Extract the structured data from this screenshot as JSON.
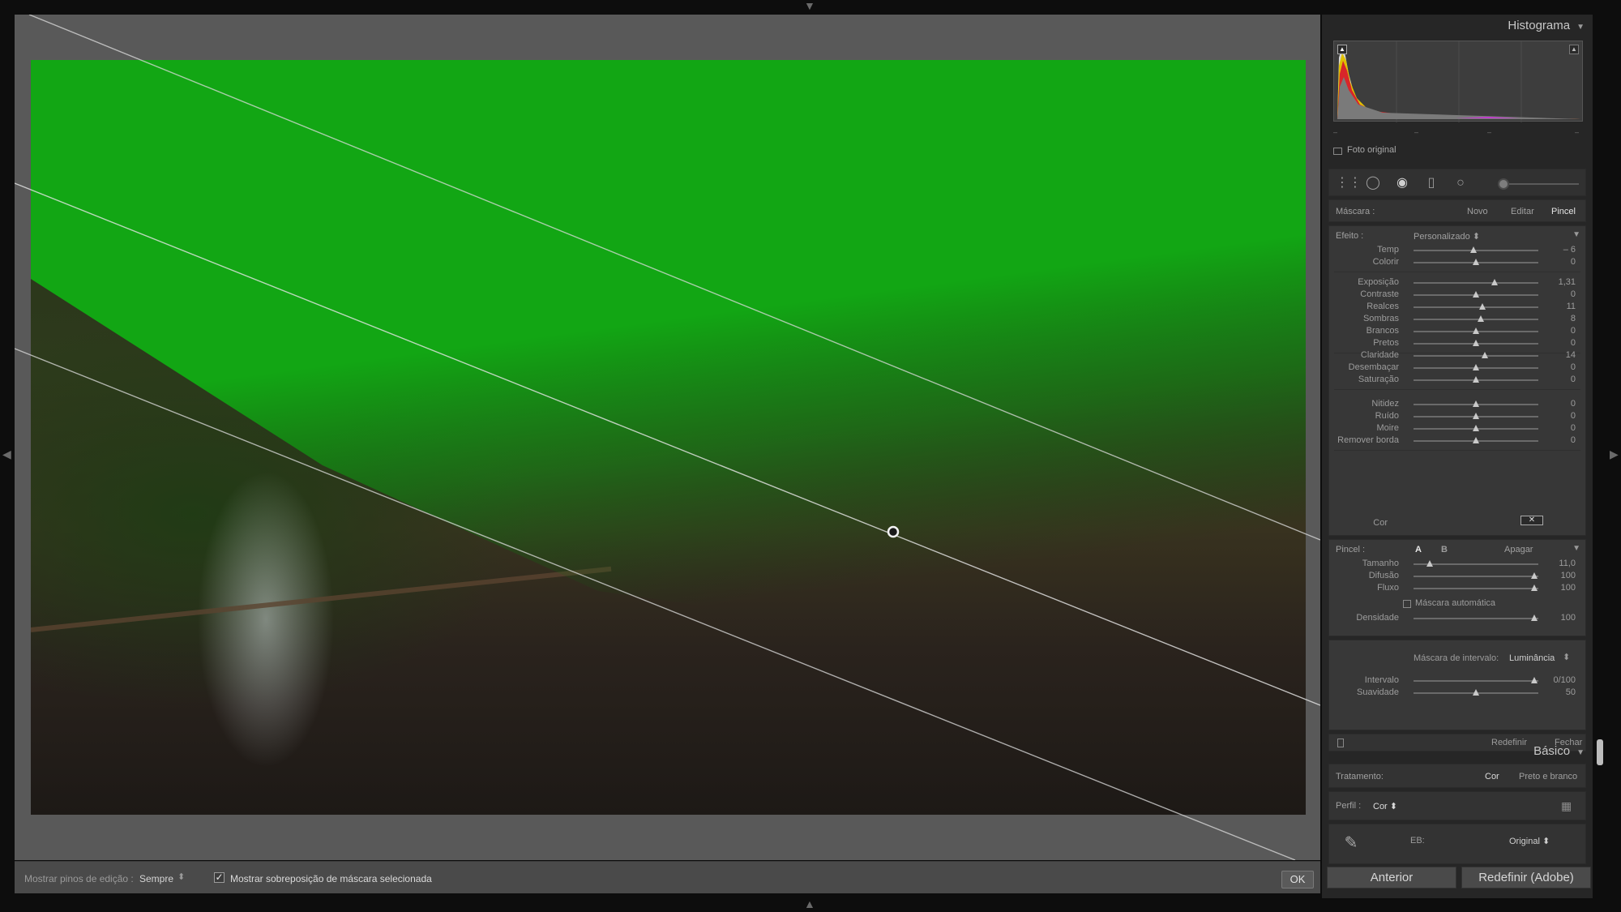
{
  "toolbar": {
    "pins_label": "Mostrar pinos de edição :",
    "pins_value": "Sempre",
    "overlay_label": "Mostrar sobreposição de máscara selecionada",
    "overlay_checked": true,
    "ok_label": "OK"
  },
  "histogram": {
    "title": "Histograma",
    "original_photo_label": "Foto original",
    "ticks": [
      "–",
      "–",
      "–",
      "–"
    ]
  },
  "mask": {
    "label": "Máscara :",
    "options": [
      "Novo",
      "Editar",
      "Pincel"
    ],
    "active": "Pincel"
  },
  "effect": {
    "label": "Efeito :",
    "value": "Personalizado",
    "groups": [
      [
        {
          "label": "Temp",
          "value": "– 6",
          "level": 0.48
        },
        {
          "label": "Colorir",
          "value": "0",
          "level": 0.5
        }
      ],
      [
        {
          "label": "Exposição",
          "value": "1,31",
          "level": 0.65
        },
        {
          "label": "Contraste",
          "value": "0",
          "level": 0.5
        },
        {
          "label": "Realces",
          "value": "11",
          "level": 0.555
        },
        {
          "label": "Sombras",
          "value": "8",
          "level": 0.54
        },
        {
          "label": "Brancos",
          "value": "0",
          "level": 0.5
        },
        {
          "label": "Pretos",
          "value": "0",
          "level": 0.5
        }
      ],
      [
        {
          "label": "Claridade",
          "value": "14",
          "level": 0.57
        },
        {
          "label": "Desembaçar",
          "value": "0",
          "level": 0.5
        },
        {
          "label": "Saturação",
          "value": "0",
          "level": 0.5
        }
      ],
      [
        {
          "label": "Nitidez",
          "value": "0",
          "level": 0.5
        },
        {
          "label": "Ruído",
          "value": "0",
          "level": 0.5
        },
        {
          "label": "Moire",
          "value": "0",
          "level": 0.5
        },
        {
          "label": "Remover borda",
          "value": "0",
          "level": 0.5
        }
      ]
    ],
    "color_label": "Cor"
  },
  "brush": {
    "label": "Pincel :",
    "a": "A",
    "b": "B",
    "erase": "Apagar",
    "sliders": [
      {
        "label": "Tamanho",
        "value": "11,0",
        "level": 0.13
      },
      {
        "label": "Difusão",
        "value": "100",
        "level": 0.97
      },
      {
        "label": "Fluxo",
        "value": "100",
        "level": 0.97
      }
    ],
    "automask_label": "Máscara automática",
    "density": {
      "label": "Densidade",
      "value": "100",
      "level": 0.97
    }
  },
  "range_mask": {
    "label": "Máscara de intervalo:",
    "value": "Luminância",
    "sliders": [
      {
        "label": "Intervalo",
        "value": "0/100",
        "level": 0.97
      },
      {
        "label": "Suavidade",
        "value": "50",
        "level": 0.5
      }
    ]
  },
  "mask_footer": {
    "reset": "Redefinir",
    "close": "Fechar"
  },
  "basic": {
    "title": "Básico",
    "treatment_label": "Tratamento:",
    "treatment_color": "Cor",
    "treatment_bw": "Preto e branco",
    "profile_label": "Perfil :",
    "profile_value": "Cor",
    "wb_label": "EB:",
    "wb_value": "Original"
  },
  "buttons": {
    "previous": "Anterior",
    "reset_adobe": "Redefinir (Adobe)"
  },
  "colors": {
    "mask_overlay": "#12a614",
    "panel_bg": "#262626",
    "canvas_bg": "#595959"
  },
  "icons": [
    "graduated-filter-icon",
    "radial-filter-icon",
    "adjustment-brush-icon",
    "crop-icon",
    "spot-removal-icon",
    "eyedropper-icon",
    "grid-icon"
  ]
}
